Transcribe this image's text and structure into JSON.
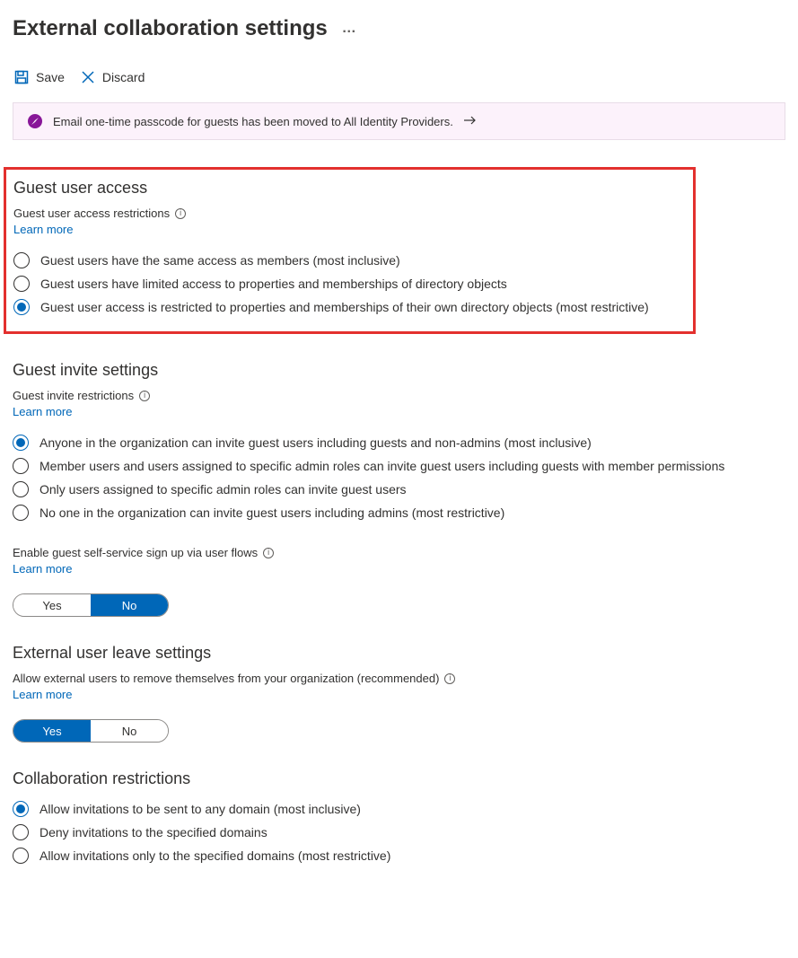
{
  "pageTitle": "External collaboration settings",
  "moreActions": "…",
  "toolbar": {
    "save": "Save",
    "discard": "Discard"
  },
  "banner": {
    "text": "Email one-time passcode for guests has been moved to All Identity Providers."
  },
  "learnMoreLabel": "Learn more",
  "guestAccess": {
    "title": "Guest user access",
    "fieldLabel": "Guest user access restrictions",
    "options": [
      "Guest users have the same access as members (most inclusive)",
      "Guest users have limited access to properties and memberships of directory objects",
      "Guest user access is restricted to properties and memberships of their own directory objects (most restrictive)"
    ],
    "selectedIndex": 2
  },
  "guestInvite": {
    "title": "Guest invite settings",
    "fieldLabel": "Guest invite restrictions",
    "options": [
      "Anyone in the organization can invite guest users including guests and non-admins (most inclusive)",
      "Member users and users assigned to specific admin roles can invite guest users including guests with member permissions",
      "Only users assigned to specific admin roles can invite guest users",
      "No one in the organization can invite guest users including admins (most restrictive)"
    ],
    "selectedIndex": 0,
    "selfServiceLabel": "Enable guest self-service sign up via user flows",
    "selfServiceYes": "Yes",
    "selfServiceNo": "No",
    "selfServiceValue": "No"
  },
  "externalLeave": {
    "title": "External user leave settings",
    "fieldLabel": "Allow external users to remove themselves from your organization (recommended)",
    "yes": "Yes",
    "no": "No",
    "value": "Yes"
  },
  "collabRestrictions": {
    "title": "Collaboration restrictions",
    "options": [
      "Allow invitations to be sent to any domain (most inclusive)",
      "Deny invitations to the specified domains",
      "Allow invitations only to the specified domains (most restrictive)"
    ],
    "selectedIndex": 0
  }
}
